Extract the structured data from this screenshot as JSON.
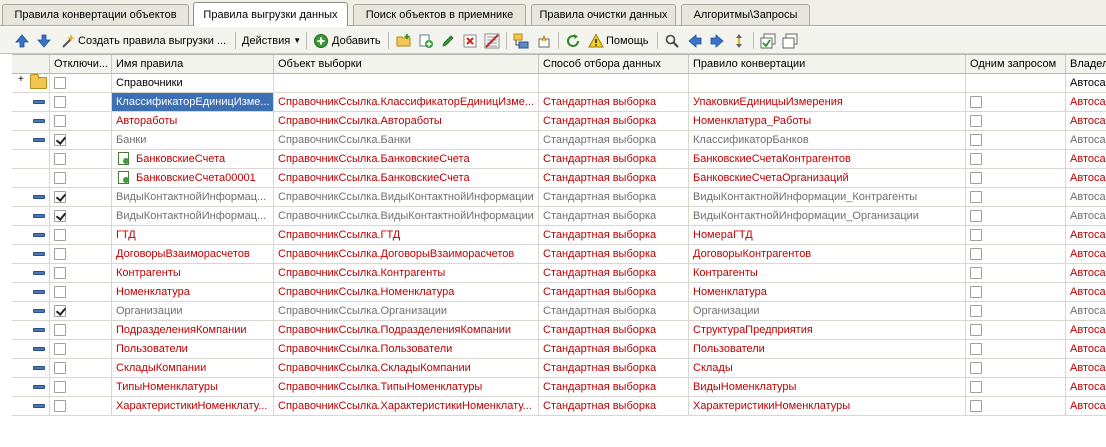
{
  "tabs": [
    {
      "label": "Правила конвертации объектов",
      "active": false
    },
    {
      "label": "Правила выгрузки данных",
      "active": true
    },
    {
      "label": "Поиск объектов в приемнике",
      "active": false
    },
    {
      "label": "Правила очистки данных",
      "active": false
    },
    {
      "label": "Алгоритмы\\Запросы",
      "active": false
    }
  ],
  "toolbar": {
    "create_label": "Создать правила выгрузки ...",
    "actions_label": "Действия",
    "add_label": "Добавить",
    "help_label": "Помощь"
  },
  "columns": [
    "Отключи...",
    "Имя правила",
    "Объект выборки",
    "Способ отбора данных",
    "Правило конвертации",
    "Одним запросом",
    "Владел"
  ],
  "group_row": {
    "name": "Справочники",
    "owner": "Автоса"
  },
  "rows": [
    {
      "off": false,
      "name": "КлассификаторЕдиницИзме...",
      "object": "СправочникСсылка.КлассификаторЕдиницИзме...",
      "method": "Стандартная выборка",
      "rule": "УпаковкиЕдиницыИзмерения",
      "owner": "Автоса",
      "style": "red",
      "selected": true,
      "icon": "dash"
    },
    {
      "off": false,
      "name": "Автоработы",
      "object": "СправочникСсылка.Автоработы",
      "method": "Стандартная выборка",
      "rule": "Номенклатура_Работы",
      "owner": "Автоса",
      "style": "red",
      "icon": "dash"
    },
    {
      "off": true,
      "name": "Банки",
      "object": "СправочникСсылка.Банки",
      "method": "Стандартная выборка",
      "rule": "КлассификаторБанков",
      "owner": "Автоса",
      "style": "gray",
      "icon": "dash"
    },
    {
      "off": false,
      "name": "БанковскиеСчета",
      "object": "СправочникСсылка.БанковскиеСчета",
      "method": "Стандартная выборка",
      "rule": "БанковскиеСчетаКонтрагентов",
      "owner": "Автоса",
      "style": "red",
      "icon": "doc"
    },
    {
      "off": false,
      "name": "БанковскиеСчета00001",
      "object": "СправочникСсылка.БанковскиеСчета",
      "method": "Стандартная выборка",
      "rule": "БанковскиеСчетаОрганизаций",
      "owner": "Автоса",
      "style": "red",
      "icon": "doc"
    },
    {
      "off": true,
      "name": "ВидыКонтактнойИнформац...",
      "object": "СправочникСсылка.ВидыКонтактнойИнформации",
      "method": "Стандартная выборка",
      "rule": "ВидыКонтактнойИнформации_Контрагенты",
      "owner": "Автоса",
      "style": "gray",
      "icon": "dash"
    },
    {
      "off": true,
      "name": "ВидыКонтактнойИнформац...",
      "object": "СправочникСсылка.ВидыКонтактнойИнформации",
      "method": "Стандартная выборка",
      "rule": "ВидыКонтактнойИнформации_Организации",
      "owner": "Автоса",
      "style": "gray",
      "icon": "dash"
    },
    {
      "off": false,
      "name": "ГТД",
      "object": "СправочникСсылка.ГТД",
      "method": "Стандартная выборка",
      "rule": "НомераГТД",
      "owner": "Автоса",
      "style": "red",
      "icon": "dash"
    },
    {
      "off": false,
      "name": "ДоговорыВзаиморасчетов",
      "object": "СправочникСсылка.ДоговорыВзаиморасчетов",
      "method": "Стандартная выборка",
      "rule": "ДоговорыКонтрагентов",
      "owner": "Автоса",
      "style": "red",
      "icon": "dash"
    },
    {
      "off": false,
      "name": "Контрагенты",
      "object": "СправочникСсылка.Контрагенты",
      "method": "Стандартная выборка",
      "rule": "Контрагенты",
      "owner": "Автоса",
      "style": "red",
      "icon": "dash"
    },
    {
      "off": false,
      "name": "Номенклатура",
      "object": "СправочникСсылка.Номенклатура",
      "method": "Стандартная выборка",
      "rule": "Номенклатура",
      "owner": "Автоса",
      "style": "red",
      "icon": "dash"
    },
    {
      "off": true,
      "name": "Организации",
      "object": "СправочникСсылка.Организации",
      "method": "Стандартная выборка",
      "rule": "Организации",
      "owner": "Автоса",
      "style": "gray",
      "icon": "dash"
    },
    {
      "off": false,
      "name": "ПодразделенияКомпании",
      "object": "СправочникСсылка.ПодразделенияКомпании",
      "method": "Стандартная выборка",
      "rule": "СтруктураПредприятия",
      "owner": "Автоса",
      "style": "red",
      "icon": "dash"
    },
    {
      "off": false,
      "name": "Пользователи",
      "object": "СправочникСсылка.Пользователи",
      "method": "Стандартная выборка",
      "rule": "Пользователи",
      "owner": "Автоса",
      "style": "red",
      "icon": "dash"
    },
    {
      "off": false,
      "name": "СкладыКомпании",
      "object": "СправочникСсылка.СкладыКомпании",
      "method": "Стандартная выборка",
      "rule": "Склады",
      "owner": "Автоса",
      "style": "red",
      "icon": "dash"
    },
    {
      "off": false,
      "name": "ТипыНоменклатуры",
      "object": "СправочникСсылка.ТипыНоменклатуры",
      "method": "Стандартная выборка",
      "rule": "ВидыНоменклатуры",
      "owner": "Автоса",
      "style": "red",
      "icon": "dash"
    },
    {
      "off": false,
      "name": "ХарактеристикиНоменклату...",
      "object": "СправочникСсылка.ХарактеристикиНоменклату...",
      "method": "Стандартная выборка",
      "rule": "ХарактеристикиНоменклатуры",
      "owner": "Автоса",
      "style": "red",
      "icon": "dash"
    }
  ]
}
